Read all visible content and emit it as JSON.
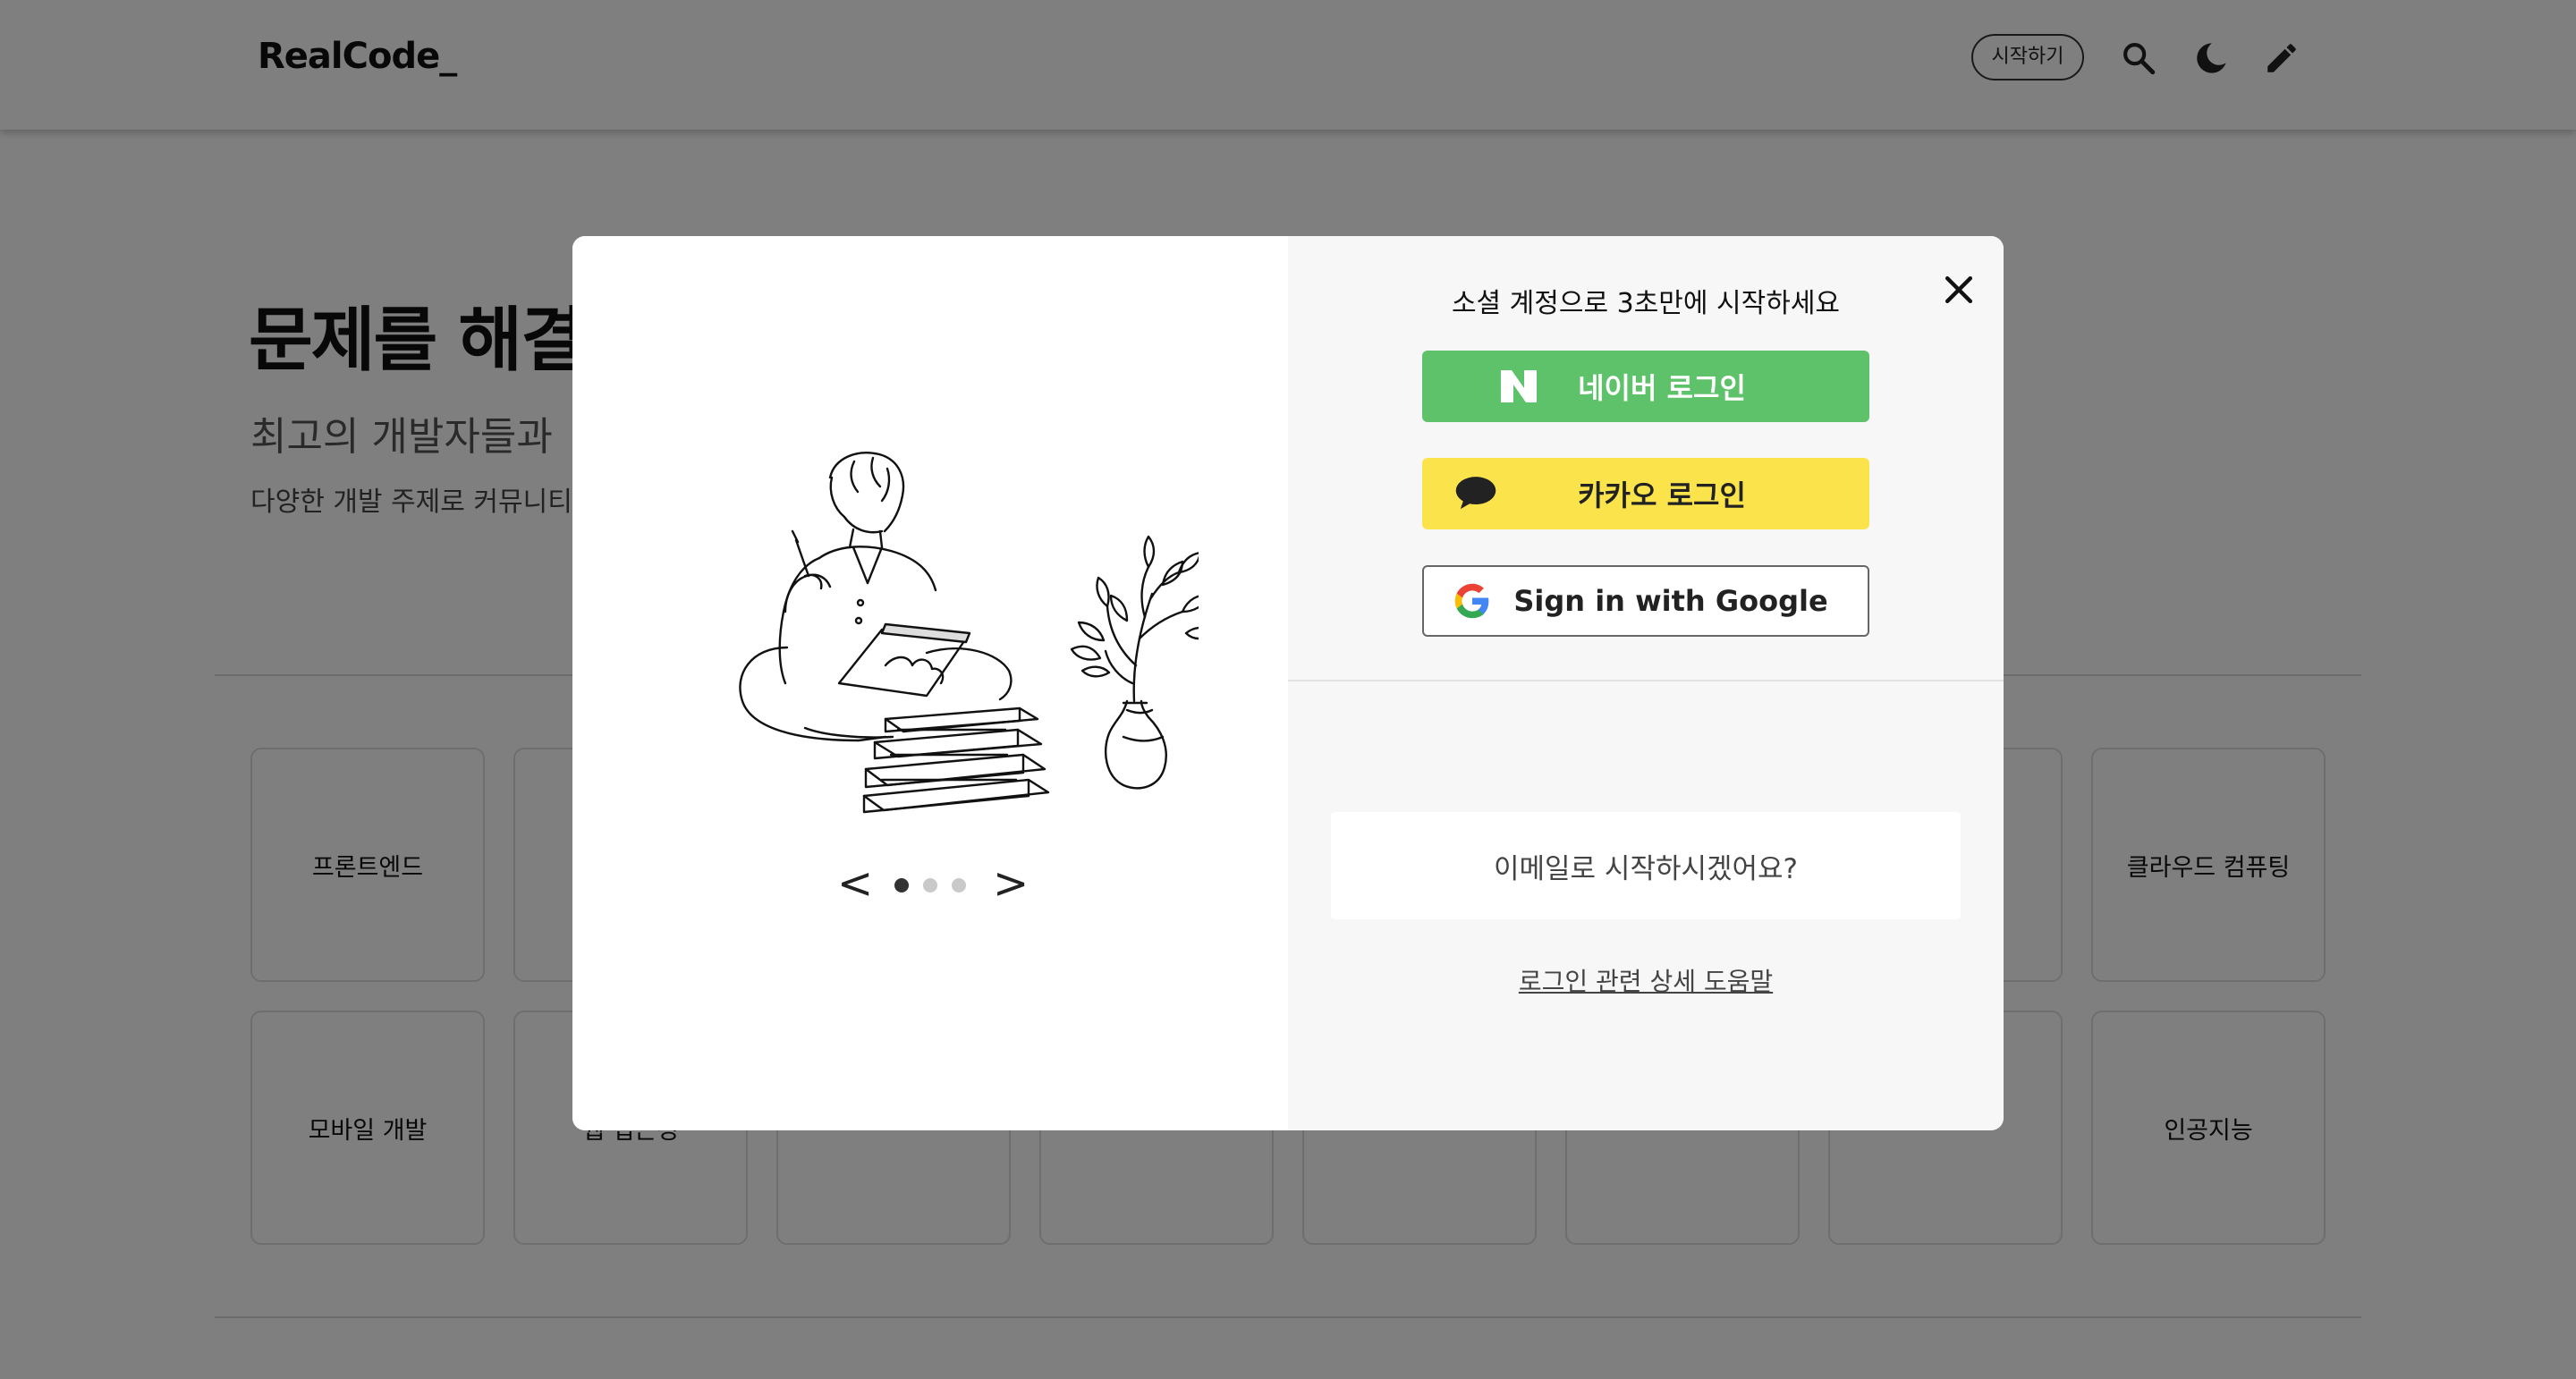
{
  "header": {
    "logo": "RealCode_",
    "start_label": "시작하기",
    "icons": [
      "search-icon",
      "moon-icon",
      "pencil-icon"
    ]
  },
  "hero": {
    "title": "문제를 해결",
    "subtitle": "최고의 개발자들과",
    "description": "다양한 개발 주제로 커뮤니티"
  },
  "categories": {
    "row1": [
      "프론트엔드",
      "",
      "",
      "",
      "",
      "",
      "",
      "클라우드 컴퓨팅"
    ],
    "row2": [
      "모바일 개발",
      "웹 접근성",
      "",
      "",
      "",
      "",
      "",
      "인공지능"
    ]
  },
  "modal": {
    "title": "소셜 계정으로 3초만에 시작하세요",
    "naver_label": "네이버 로그인",
    "kakao_label": "카카오 로그인",
    "google_label": "Sign in with Google",
    "email_label": "이메일로 시작하시겠어요?",
    "help_label": "로그인 관련 상세 도움말",
    "carousel": {
      "prev": "<",
      "next": ">",
      "active_index": 0,
      "count": 3
    }
  },
  "colors": {
    "naver": "#5ec26a",
    "kakao": "#fbe44b",
    "overlay": "rgba(0,0,0,0.5)"
  }
}
